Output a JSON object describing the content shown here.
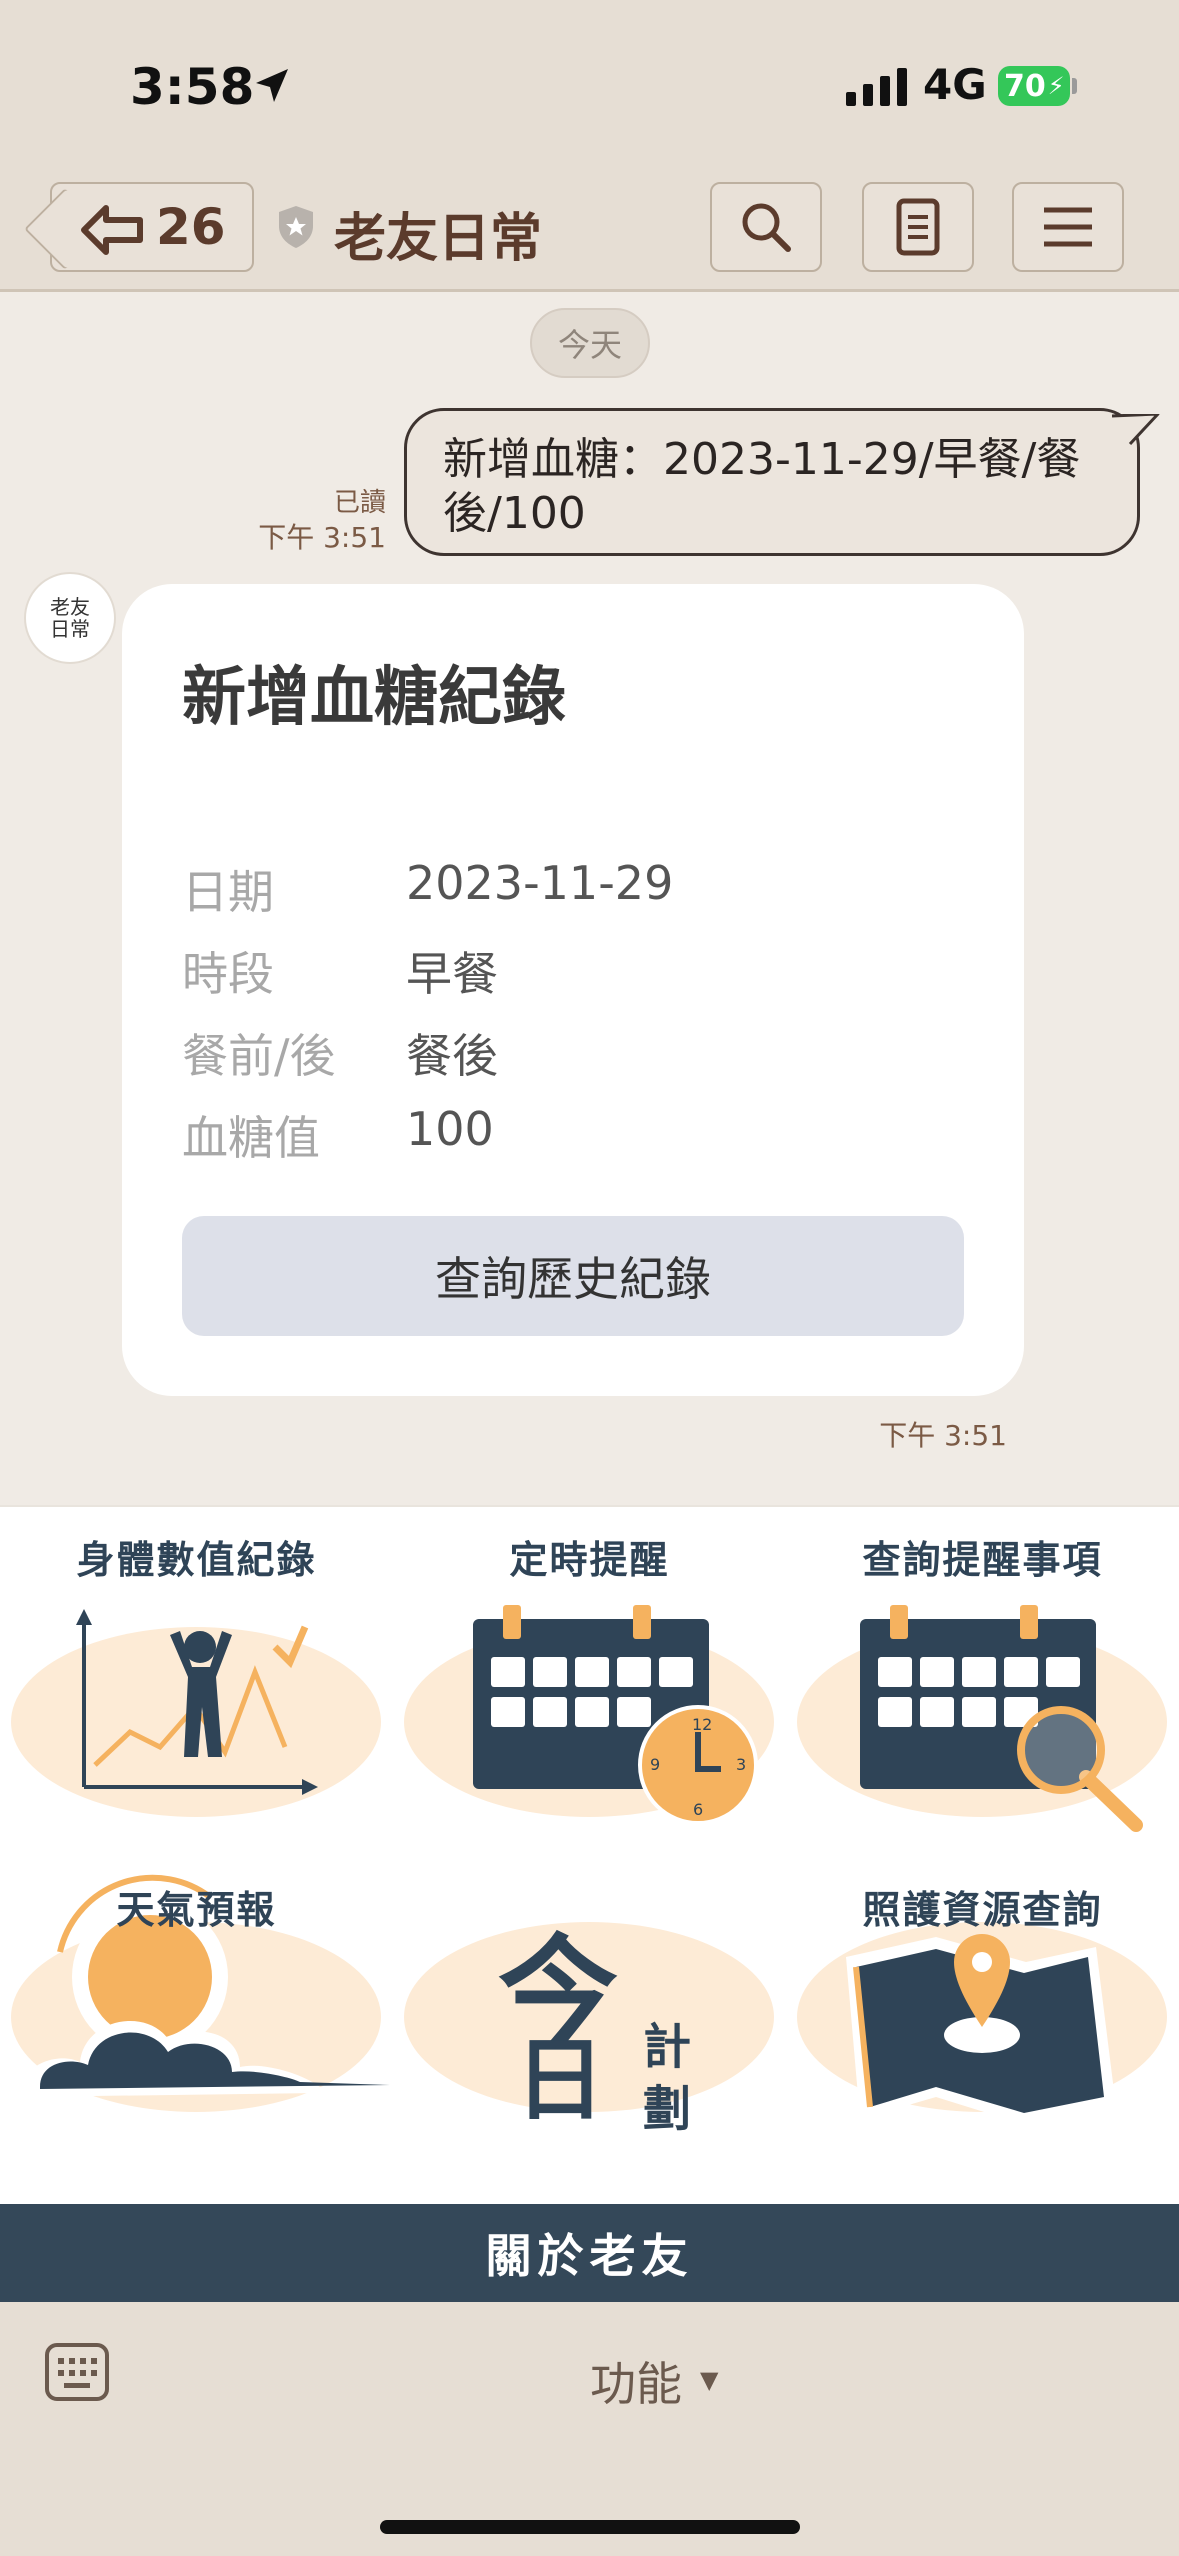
{
  "status": {
    "time": "3:58",
    "network": "4G",
    "battery": "70"
  },
  "header": {
    "unread_count": "26",
    "chat_title": "老友日常"
  },
  "chat": {
    "date_divider": "今天",
    "sent": {
      "text": "新增血糖：2023-11-29/早餐/餐後/100",
      "read": "已讀",
      "time": "下午 3:51"
    },
    "bot_avatar_text": "老友日常",
    "card": {
      "title": "新增血糖紀錄",
      "rows": [
        {
          "label": "日期",
          "value": "2023-11-29"
        },
        {
          "label": "時段",
          "value": "早餐"
        },
        {
          "label": "餐前/後",
          "value": "餐後"
        },
        {
          "label": "血糖值",
          "value": "100"
        }
      ],
      "button": "查詢歷史紀錄",
      "time": "下午 3:51"
    }
  },
  "richmenu": {
    "items": [
      {
        "label": "身體數值紀錄",
        "icon": "chart-person-icon"
      },
      {
        "label": "定時提醒",
        "icon": "calendar-clock-icon"
      },
      {
        "label": "查詢提醒事項",
        "icon": "calendar-search-icon"
      },
      {
        "label": "天氣預報",
        "icon": "sun-cloud-icon"
      },
      {
        "label": "今日計劃",
        "big1": "今",
        "big2": "日",
        "small1": "計",
        "small2": "劃"
      },
      {
        "label": "照護資源查詢",
        "icon": "map-pin-icon"
      }
    ],
    "about": "關於老友"
  },
  "bottombar": {
    "menu_label": "功能"
  },
  "colors": {
    "navy": "#344859",
    "accent": "#f5b25f",
    "bubble_border": "#3e3430",
    "header_bg": "#e6ded4"
  }
}
